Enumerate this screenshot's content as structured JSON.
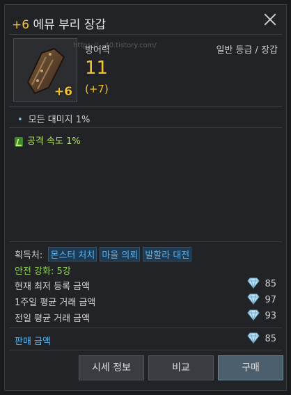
{
  "title": {
    "enhance": "+6",
    "name": "에뮤 부리 장갑"
  },
  "item": {
    "enhance_badge": "+6"
  },
  "watermark": "https://...40.tistory.com/",
  "stat": {
    "label": "방어력",
    "value": "11",
    "bonus": "(+7)"
  },
  "grade": "일반 등급 / 장갑",
  "options": [
    {
      "text": "모든 대미지 1%"
    },
    {
      "text": "공격 속도 1%"
    }
  ],
  "acquire": {
    "label": "획득처:",
    "sources": [
      "몬스터 처치",
      "마을 의뢰",
      "발할라 대전"
    ]
  },
  "safe_enhance": "안전 강화: 5강",
  "prices": [
    {
      "label": "현재 최저 등록 금액",
      "value": "85"
    },
    {
      "label": "1주일 평균 거래 금액",
      "value": "97"
    },
    {
      "label": "전일 평균 거래 금액",
      "value": "93"
    },
    {
      "label": "판매 금액",
      "value": "85"
    }
  ],
  "buttons": {
    "market": "시세 정보",
    "compare": "비교",
    "buy": "구매"
  },
  "colors": {
    "gold": "#f1c232",
    "link_blue": "#5ab4f0",
    "safe_green": "#8fd14f"
  }
}
